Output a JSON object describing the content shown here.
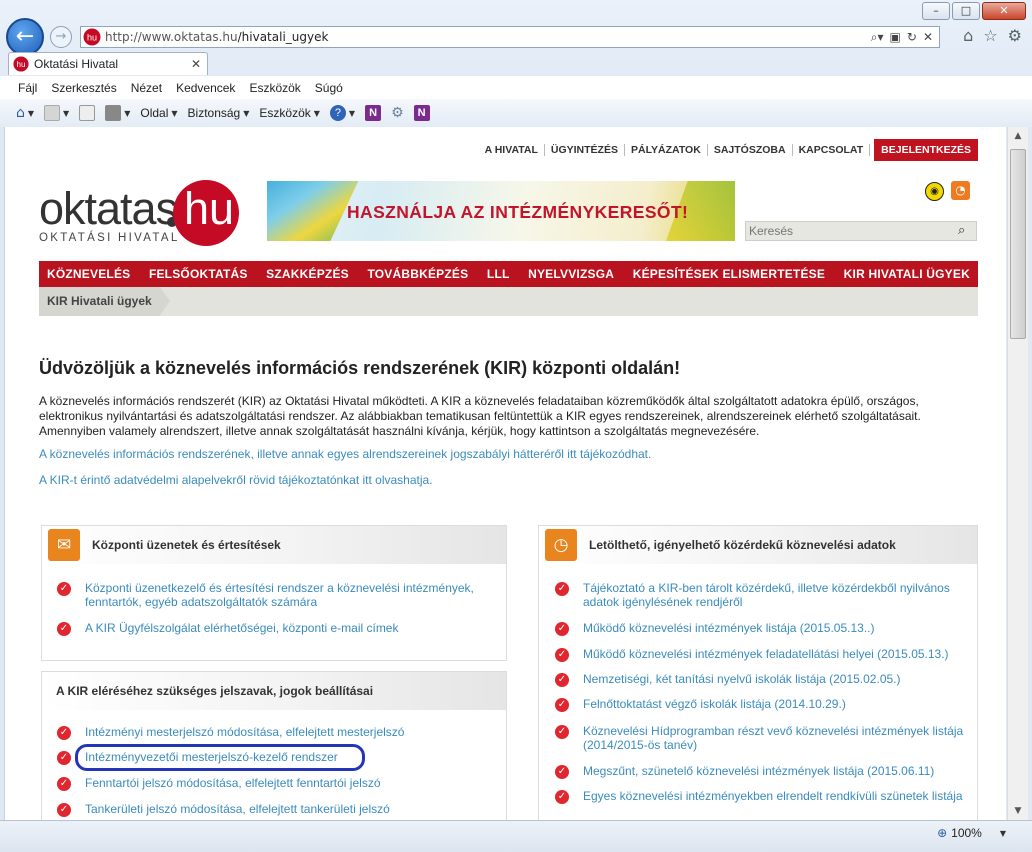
{
  "browser": {
    "url_host": "http://www.oktatas.hu",
    "url_path": "/hivatali_ugyek",
    "tab_title": "Oktatási Hivatal",
    "favicon_text": "hu",
    "menu": [
      "Fájl",
      "Szerkesztés",
      "Nézet",
      "Kedvencek",
      "Eszközök",
      "Súgó"
    ],
    "commands": [
      "Oldal",
      "Biztonság",
      "Eszközök"
    ],
    "zoom": "100%"
  },
  "site": {
    "topnav": [
      "A HIVATAL",
      "ÜGYINTÉZÉS",
      "PÁLYÁZATOK",
      "SAJTÓSZOBA",
      "KAPCSOLAT"
    ],
    "login": "BEJELENTKEZÉS",
    "logo_word": "oktatas",
    "logo_hu": "hu",
    "logo_sub": "OKTATÁSI HIVATAL",
    "banner_text": "HASZNÁLJA AZ INTÉZMÉNYKERESŐT!",
    "search_placeholder": "Keresés",
    "mainnav": [
      "KÖZNEVELÉS",
      "FELSŐOKTATÁS",
      "SZAKKÉPZÉS",
      "TOVÁBBKÉPZÉS",
      "LLL",
      "NYELVVIZSGA",
      "KÉPESÍTÉSEK ELISMERTETÉSE",
      "KIR HIVATALI ÜGYEK"
    ],
    "breadcrumb": "KIR Hivatali ügyek",
    "heading": "Üdvözöljük a köznevelés információs rendszerének (KIR) központi oldalán!",
    "intro": "A köznevelés információs rendszerét (KIR) az Oktatási Hivatal működteti. A KIR a köznevelés feladataiban közreműködők által szolgáltatott adatokra épülő, országos, elektronikus nyilvántartási és adatszolgáltatási rendszer. Az alábbiakban tematikusan feltüntettük a KIR egyes rendszereinek, alrendszereinek elérhető szolgáltatásait. Amennyiben valamely alrendszert, illetve annak szolgáltatását használni kívánja, kérjük, hogy kattintson a szolgáltatás megnevezésére.",
    "link1": "A köznevelés információs rendszerének, illetve annak egyes alrendszereinek jogszabályi hátteréről itt tájékozódhat.",
    "link2": "A KIR-t érintő adatvédelmi alapelvekről rövid tájékoztatónkat itt olvashatja.",
    "box1": {
      "title": "Központi üzenetek és értesítések",
      "items": [
        "Központi üzenetkezelő és értesítési rendszer a köznevelési intézmények, fenntartók, egyéb adatszolgáltatók számára",
        "A KIR Ügyfélszolgálat elérhetőségei, központi e-mail címek"
      ]
    },
    "box2": {
      "title": "A KIR eléréséhez szükséges jelszavak, jogok beállításai",
      "items": [
        "Intézményi mesterjelszó módosítása, elfelejtett mesterjelszó",
        "Intézményvezetői mesterjelszó-kezelő rendszer",
        "Fenntartói jelszó módosítása, elfelejtett fenntartói jelszó",
        "Tankerületi jelszó módosítása, elfelejtett tankerületi jelszó"
      ]
    },
    "box3": {
      "title": "Letölthető, igényelhető közérdekű köznevelési adatok",
      "items": [
        "Tájékoztató a KIR-ben tárolt közérdekű, illetve közérdekből nyilvános adatok igénylésének rendjéről",
        "Működő köznevelési intézmények listája (2015.05.13..)",
        "Működő köznevelési intézmények feladatellátási helyei (2015.05.13.)",
        "Nemzetiségi, két tanítási nyelvű iskolák listája (2015.02.05.)",
        "Felnőttoktatást végző iskolák listája (2014.10.29.)",
        "Köznevelési Hídprogramban részt vevő köznevelési intézmények listája (2014/2015-ös tanév)",
        "Megszűnt, szünetelő köznevelési intézmények listája (2015.06.11)",
        "Egyes köznevelési intézményekben elrendelt rendkívüli szünetek listája"
      ]
    },
    "colors": {
      "brand_red": "#c1121f",
      "link_blue": "#3a8bbd",
      "icon_orange": "#e8851f",
      "highlight_blue": "#2535b8"
    }
  }
}
